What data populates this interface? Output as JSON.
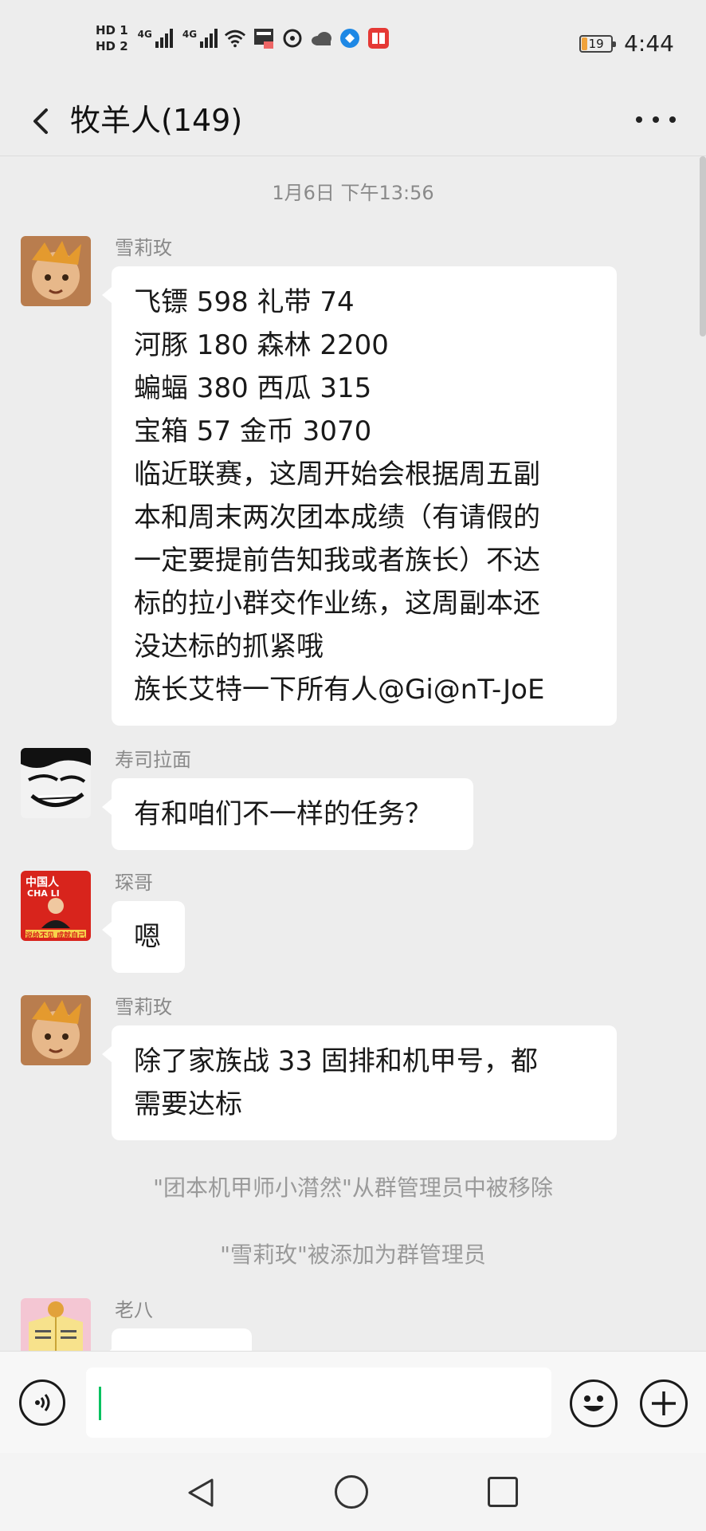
{
  "status_bar": {
    "hd1": "HD 1",
    "hd2": "HD 2",
    "net1": "4G",
    "net2": "4G",
    "battery": "19",
    "time": "4:44"
  },
  "header": {
    "title": "牧羊人(149)"
  },
  "chat": {
    "timestamp": "1月6日 下午13:56",
    "messages": [
      {
        "sender": "雪莉玫",
        "text": "飞镖 598 礼带 74\n河豚 180 森林 2200\n蝙蝠 380 西瓜 315\n宝箱 57 金币 3070\n临近联赛，这周开始会根据周五副\n本和周末两次团本成绩（有请假的\n一定要提前告知我或者族长）不达\n标的拉小群交作业练，这周副本还\n没达标的抓紧哦\n族长艾特一下所有人@Gi@nT-JoE"
      },
      {
        "sender": "寿司拉面",
        "text": "有和咱们不一样的任务？"
      },
      {
        "sender": "琛哥",
        "text": "嗯"
      },
      {
        "sender": "雪莉玫",
        "text": "除了家族战 33 固排和机甲号，都\n需要达标"
      },
      {
        "sender": "老八",
        "text": ""
      }
    ],
    "system_messages": [
      "\"团本机甲师小潸然\"从群管理员中被移除",
      "\"雪莉玫\"被添加为群管理员"
    ]
  },
  "avatars": {
    "a1_bg": "#c28a5a",
    "a3_banner": "中国人",
    "a3_sub": "CHA  LI",
    "a3_slogan": "说给不见 成就自己"
  },
  "input": {
    "value": ""
  },
  "colors": {
    "accent": "#07c160",
    "bubble": "#ffffff",
    "background": "#ededed"
  }
}
